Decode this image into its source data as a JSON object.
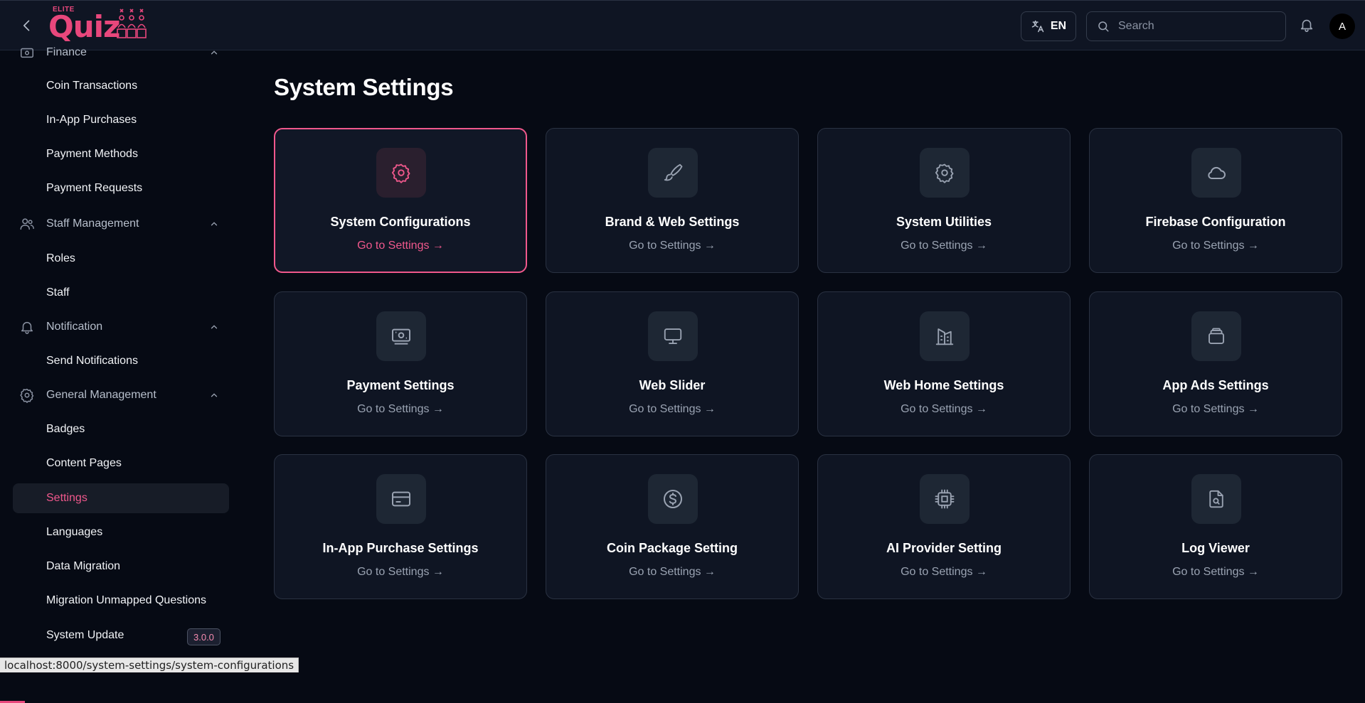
{
  "header": {
    "logo_small": "ELITE",
    "logo_main": "Quiz",
    "language": "EN",
    "search_placeholder": "Search",
    "avatar_initial": "A"
  },
  "sidebar": {
    "finance_group": "Finance",
    "finance_items": [
      "Coin Transactions",
      "In-App Purchases",
      "Payment Methods",
      "Payment Requests"
    ],
    "staff_group": "Staff Management",
    "staff_items": [
      "Roles",
      "Staff"
    ],
    "notification_group": "Notification",
    "notification_items": [
      "Send Notifications"
    ],
    "general_group": "General Management",
    "general_items": [
      "Badges",
      "Content Pages",
      "Settings",
      "Languages",
      "Data Migration",
      "Migration Unmapped Questions",
      "System Update"
    ],
    "active_item": "Settings",
    "version": "3.0.0"
  },
  "main": {
    "title": "System Settings",
    "cards": [
      {
        "title": "System Configurations",
        "link": "Go to Settings →",
        "icon": "gear-icon"
      },
      {
        "title": "Brand & Web Settings",
        "link": "Go to Settings →",
        "icon": "brush-icon"
      },
      {
        "title": "System Utilities",
        "link": "Go to Settings →",
        "icon": "gear-icon"
      },
      {
        "title": "Firebase Configuration",
        "link": "Go to Settings →",
        "icon": "cloud-icon"
      },
      {
        "title": "Payment Settings",
        "link": "Go to Settings →",
        "icon": "cash-icon"
      },
      {
        "title": "Web Slider",
        "link": "Go to Settings →",
        "icon": "monitor-icon"
      },
      {
        "title": "Web Home Settings",
        "link": "Go to Settings →",
        "icon": "building-icon"
      },
      {
        "title": "App Ads Settings",
        "link": "Go to Settings →",
        "icon": "stack-icon"
      },
      {
        "title": "In-App Purchase Settings",
        "link": "Go to Settings →",
        "icon": "credit-card-icon"
      },
      {
        "title": "Coin Package Setting",
        "link": "Go to Settings →",
        "icon": "dollar-coin-icon"
      },
      {
        "title": "AI Provider Setting",
        "link": "Go to Settings →",
        "icon": "cpu-icon"
      },
      {
        "title": "Log Viewer",
        "link": "Go to Settings →",
        "icon": "file-search-icon"
      }
    ]
  },
  "status_bar": {
    "url": "localhost:8000/system-settings/system-configurations"
  },
  "colors": {
    "accent": "#f0588c",
    "background": "#060a14",
    "card": "#0f1523"
  }
}
